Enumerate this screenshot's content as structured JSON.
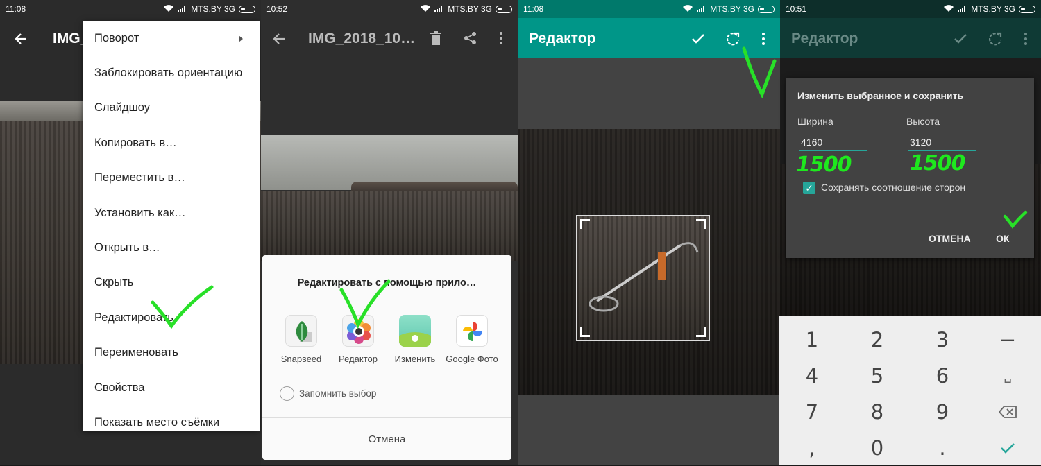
{
  "panel1": {
    "status": {
      "time": "11:08",
      "carrier": "MTS.BY 3G"
    },
    "toolbar": {
      "title": "IMG_"
    },
    "menu": {
      "items": [
        {
          "label": "Поворот"
        },
        {
          "label": "Заблокировать ориентацию"
        },
        {
          "label": "Слайдшоу"
        },
        {
          "label": "Копировать в…"
        },
        {
          "label": "Переместить в…"
        },
        {
          "label": "Установить как…"
        },
        {
          "label": "Открыть в…"
        },
        {
          "label": "Скрыть"
        },
        {
          "label": "Редактировать"
        },
        {
          "label": "Переименовать"
        },
        {
          "label": "Свойства"
        },
        {
          "label": "Показать место съёмки"
        }
      ]
    }
  },
  "panel2": {
    "status": {
      "time": "10:52",
      "carrier": "MTS.BY 3G"
    },
    "toolbar": {
      "title": "IMG_2018_10…"
    },
    "chooser": {
      "title": "Редактировать с помощью прило…",
      "apps": [
        {
          "label": "Snapseed",
          "icon": "snapseed-icon"
        },
        {
          "label": "Редактор",
          "icon": "editor-icon"
        },
        {
          "label": "Изменить",
          "icon": "gallery-edit-icon"
        },
        {
          "label": "Google Фото",
          "icon": "google-photos-icon"
        }
      ],
      "remember_label": "Запомнить выбор",
      "cancel_label": "Отмена"
    }
  },
  "panel3": {
    "status": {
      "time": "11:08",
      "carrier": "MTS.BY 3G"
    },
    "toolbar": {
      "title": "Редактор",
      "accent": "#009688"
    }
  },
  "panel4": {
    "status": {
      "time": "10:51",
      "carrier": "MTS.BY 3G"
    },
    "toolbar": {
      "title": "Редактор"
    },
    "dialog": {
      "title": "Изменить выбранное и сохранить",
      "width_label": "Ширина",
      "height_label": "Высота",
      "width_value": "4160",
      "height_value": "3120",
      "keep_ratio_label": "Сохранять соотношение сторон",
      "keep_ratio_checked": true,
      "cancel_label": "ОТМЕНА",
      "ok_label": "ОК"
    },
    "keyboard": {
      "keys": [
        "1",
        "2",
        "3",
        "−",
        "4",
        "5",
        "6",
        "␣",
        "7",
        "8",
        "9",
        "⌫",
        "",
        "0",
        ".",
        "✓"
      ]
    }
  },
  "annotations": {
    "width_note": "1500",
    "height_note": "1500"
  }
}
